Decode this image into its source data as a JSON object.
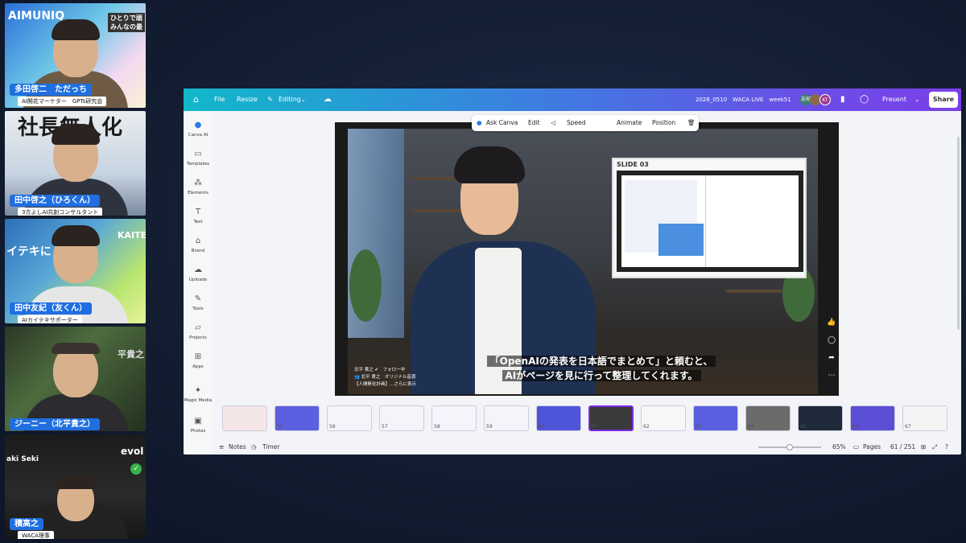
{
  "participants": [
    {
      "name": "多田啓二　ただっち",
      "role": "AI開花マーケター　GPTs研究会",
      "banner": "AIMUNIQ",
      "banner_right": "ひとりで頑\nみんなの最"
    },
    {
      "name": "田中啓之（ひろくん）",
      "role": "3方よしAI共創コンサルタント",
      "banner": "社長無人化"
    },
    {
      "name": "田中友紀（友くん）",
      "role": "AIカイテキサポーター",
      "banner": "KAITE",
      "banner_left": "イテキに"
    },
    {
      "name": "ジーニー（北平貴之）",
      "role": "",
      "banner": "平貴之"
    },
    {
      "name": "積高之",
      "role": "WACA理事",
      "banner": "evol",
      "banner_left": "aki Seki"
    }
  ],
  "topbar": {
    "file": "File",
    "resize": "Resize",
    "editing": "Editing",
    "doc_title": "2026_0510　WACA LIVE　week51",
    "avatar1": "友紀",
    "avatar2": "KT",
    "present": "Present",
    "share": "Share"
  },
  "sidebar": [
    {
      "label": "Canva AI",
      "icon": "canva-ai-icon"
    },
    {
      "label": "Templates",
      "icon": "templates-icon"
    },
    {
      "label": "Elements",
      "icon": "elements-icon"
    },
    {
      "label": "Text",
      "icon": "text-icon"
    },
    {
      "label": "Brand",
      "icon": "brand-icon"
    },
    {
      "label": "Uploads",
      "icon": "uploads-icon"
    },
    {
      "label": "Tools",
      "icon": "tools-icon"
    },
    {
      "label": "Projects",
      "icon": "projects-icon"
    },
    {
      "label": "Apps",
      "icon": "apps-icon"
    },
    {
      "label": "Magic Media",
      "icon": "magic-media-icon"
    },
    {
      "label": "Photos",
      "icon": "photos-icon"
    }
  ],
  "floating_toolbar": {
    "ask_canva": "Ask Canva",
    "edit": "Edit",
    "speed": "Speed",
    "animate": "Animate",
    "position": "Position"
  },
  "slide": {
    "inset_label": "SLIDE 03",
    "subtitle_line1": "「OpenAIの発表を日本語でまとめて」と頼むと、",
    "subtitle_line2": "AIがページを見に行って整理してくれます。",
    "byline1": "北平 貴之 ✔　フォロー中",
    "byline2": "👥 北平 貴之　オリジナル音源",
    "byline3": "【人間無化計画】…さらに表示"
  },
  "thumbnails": [
    {
      "num": "",
      "color": "#f4e6e6"
    },
    {
      "num": "55",
      "color": "#5b5fe0"
    },
    {
      "num": "56",
      "color": "#f4f4fa"
    },
    {
      "num": "57",
      "color": "#f4f4fa"
    },
    {
      "num": "58",
      "color": "#f4f4fa"
    },
    {
      "num": "59",
      "color": "#f4f4fa"
    },
    {
      "num": "60",
      "color": "#4f55d8"
    },
    {
      "num": "61",
      "color": "#3a3a3a"
    },
    {
      "num": "62",
      "color": "#f7f7f7"
    },
    {
      "num": "63",
      "color": "#5a5fe0"
    },
    {
      "num": "64",
      "color": "#6b6b6b"
    },
    {
      "num": "65",
      "color": "#1e2a3a"
    },
    {
      "num": "66",
      "color": "#5b4fd6"
    },
    {
      "num": "67",
      "color": "#f4f4f4"
    }
  ],
  "bottombar": {
    "notes": "Notes",
    "timer": "Timer",
    "zoom": "65%",
    "pages": "Pages",
    "page_count": "61 / 251",
    "zoom_level": 0.5
  }
}
